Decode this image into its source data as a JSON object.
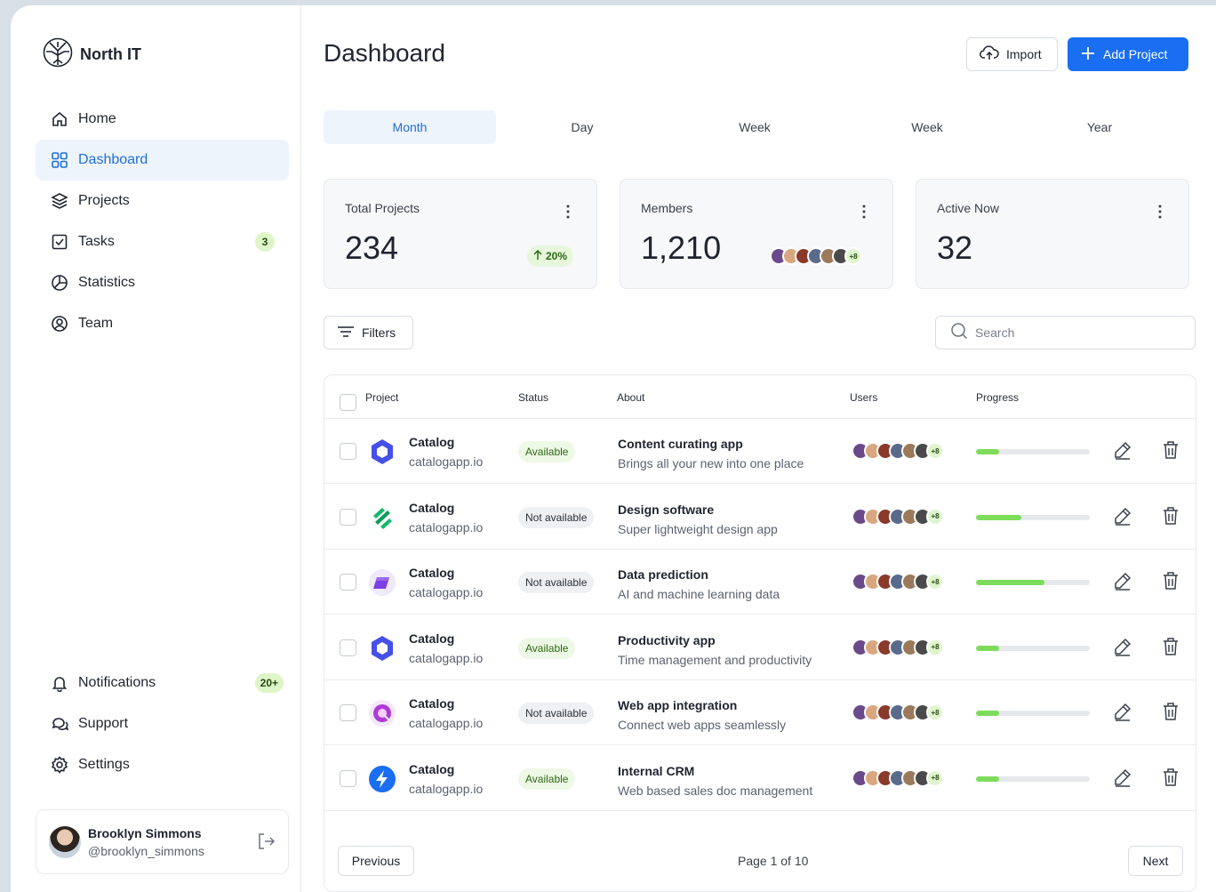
{
  "brand": {
    "name": "North IT"
  },
  "sidebar": {
    "items": [
      {
        "label": "Home",
        "icon": "home-icon"
      },
      {
        "label": "Dashboard",
        "icon": "grid-icon",
        "active": true
      },
      {
        "label": "Projects",
        "icon": "layers-icon"
      },
      {
        "label": "Tasks",
        "icon": "checkbox-icon",
        "badge": "3"
      },
      {
        "label": "Statistics",
        "icon": "pie-chart-icon"
      },
      {
        "label": "Team",
        "icon": "user-circle-icon"
      }
    ],
    "bottom_items": [
      {
        "label": "Notifications",
        "icon": "bell-icon",
        "badge": "20+"
      },
      {
        "label": "Support",
        "icon": "chat-icon"
      },
      {
        "label": "Settings",
        "icon": "gear-icon"
      }
    ],
    "user": {
      "name": "Brooklyn Simmons",
      "handle": "@brooklyn_simmons"
    }
  },
  "header": {
    "title": "Dashboard",
    "import_label": "Import",
    "add_label": "Add Project"
  },
  "tabs": [
    "Month",
    "Day",
    "Week",
    "Week",
    "Year"
  ],
  "stats": {
    "total": {
      "label": "Total Projects",
      "value": "234",
      "trend": "20%"
    },
    "members": {
      "label": "Members",
      "value": "1,210",
      "more": "+8"
    },
    "active": {
      "label": "Active Now",
      "value": "32"
    }
  },
  "toolbar": {
    "filters_label": "Filters",
    "search_placeholder": "Search"
  },
  "table": {
    "headers": {
      "project": "Project",
      "status": "Status",
      "about": "About",
      "users": "Users",
      "progress": "Progress"
    },
    "rows": [
      {
        "name": "Catalog",
        "url": "catalogapp.io",
        "status": "Available",
        "available": true,
        "title": "Content curating app",
        "desc": "Brings all your new into one place",
        "users_more": "+8",
        "progress": 0.2,
        "logo": "hexagon-logo-icon"
      },
      {
        "name": "Catalog",
        "url": "catalogapp.io",
        "status": "Not available",
        "available": false,
        "title": "Design software",
        "desc": "Super lightweight design app",
        "users_more": "+8",
        "progress": 0.4,
        "logo": "stripes-logo-icon"
      },
      {
        "name": "Catalog",
        "url": "catalogapp.io",
        "status": "Not available",
        "available": false,
        "title": "Data prediction",
        "desc": "AI and machine learning data",
        "users_more": "+8",
        "progress": 0.6,
        "logo": "prism-logo-icon"
      },
      {
        "name": "Catalog",
        "url": "catalogapp.io",
        "status": "Available",
        "available": true,
        "title": "Productivity app",
        "desc": "Time management and productivity",
        "users_more": "+8",
        "progress": 0.2,
        "logo": "hexagon-logo-icon"
      },
      {
        "name": "Catalog",
        "url": "catalogapp.io",
        "status": "Not available",
        "available": false,
        "title": "Web app integration",
        "desc": "Connect web apps seamlessly",
        "users_more": "+8",
        "progress": 0.2,
        "logo": "orb-logo-icon"
      },
      {
        "name": "Catalog",
        "url": "catalogapp.io",
        "status": "Available",
        "available": true,
        "title": "Internal CRM",
        "desc": "Web based sales doc management",
        "users_more": "+8",
        "progress": 0.2,
        "logo": "bolt-logo-icon"
      }
    ]
  },
  "pagination": {
    "prev_label": "Previous",
    "next_label": "Next",
    "page_info": "Page 1 of 10"
  },
  "colors": {
    "accent": "#1a6ef2",
    "active_bg": "#eef4fc",
    "progress": "#7ddc5a",
    "badge_bg": "#def5c8"
  }
}
